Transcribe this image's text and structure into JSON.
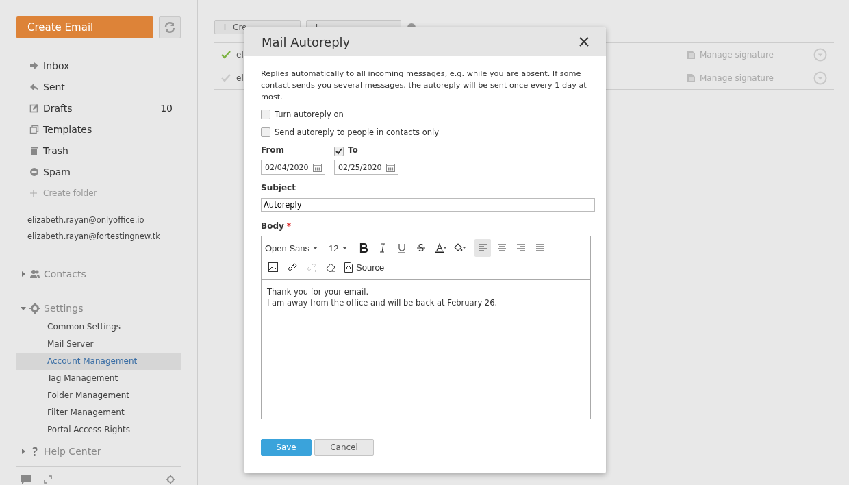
{
  "sidebar": {
    "create_button": "Create Email",
    "folders": [
      {
        "kind": "inbox",
        "label": "Inbox"
      },
      {
        "kind": "sent",
        "label": "Sent"
      },
      {
        "kind": "drafts",
        "label": "Drafts",
        "count": "10"
      },
      {
        "kind": "templates",
        "label": "Templates"
      },
      {
        "kind": "trash",
        "label": "Trash"
      },
      {
        "kind": "spam",
        "label": "Spam"
      }
    ],
    "create_folder": "Create folder",
    "accounts": [
      "elizabeth.rayan@onlyoffice.io",
      "elizabeth.rayan@fortestingnew.tk"
    ],
    "sections": [
      {
        "kind": "contacts",
        "label": "Contacts",
        "expanded": false
      },
      {
        "kind": "settings",
        "label": "Settings",
        "expanded": true,
        "children": [
          {
            "label": "Common Settings",
            "selected": false
          },
          {
            "label": "Mail Server",
            "selected": false
          },
          {
            "label": "Account Management",
            "selected": true
          },
          {
            "label": "Tag Management",
            "selected": false
          },
          {
            "label": "Folder Management",
            "selected": false
          },
          {
            "label": "Filter Management",
            "selected": false
          },
          {
            "label": "Portal Access Rights",
            "selected": false
          }
        ]
      },
      {
        "kind": "help",
        "label": "Help Center",
        "expanded": false
      }
    ]
  },
  "toolbar": {
    "buttons": [
      {
        "kind": "add",
        "label": "Cre"
      },
      {
        "kind": "add"
      }
    ]
  },
  "accounts_table": {
    "rows": [
      {
        "address": "el",
        "default": true,
        "action": "Manage signature"
      },
      {
        "address": "el",
        "default": false,
        "action": "Manage signature"
      }
    ]
  },
  "dialog": {
    "title": "Mail Autoreply",
    "description": "Replies automatically to all incoming messages, e.g. while you are absent. If some contact sends you several messages, the autoreply will be sent once every 1 day at most.",
    "options": [
      {
        "label": "Turn autoreply on",
        "checked": false
      },
      {
        "label": "Send autoreply to people in contacts only",
        "checked": false
      }
    ],
    "from": {
      "label": "From",
      "value": "02/04/2020"
    },
    "to": {
      "label": "To",
      "checked": true,
      "value": "02/25/2020"
    },
    "subject": {
      "label": "Subject",
      "value": "Autoreply"
    },
    "body": {
      "label": "Body",
      "required_mark": "*",
      "font": "Open Sans",
      "size": "12",
      "tools": [
        {
          "kind": "bold",
          "active": false
        },
        {
          "kind": "italic",
          "active": false
        },
        {
          "kind": "underline",
          "active": false
        },
        {
          "kind": "strike",
          "active": false
        },
        {
          "kind": "color",
          "active": false
        },
        {
          "kind": "fill",
          "active": false
        },
        {
          "kind": "align-left",
          "active": true
        },
        {
          "kind": "align-center",
          "active": false
        },
        {
          "kind": "align-right",
          "active": false
        },
        {
          "kind": "justify",
          "active": false
        }
      ],
      "tools2": [
        {
          "kind": "image",
          "disabled": false
        },
        {
          "kind": "link",
          "disabled": false
        },
        {
          "kind": "unlink",
          "disabled": true
        },
        {
          "kind": "eraser",
          "disabled": false
        }
      ],
      "source": "Source",
      "lines": [
        "Thank you for your email.",
        "I am away from the office and will be back at February 26."
      ]
    },
    "buttons": [
      {
        "kind": "primary",
        "label": "Save"
      },
      {
        "kind": "secondary",
        "label": "Cancel"
      }
    ]
  }
}
